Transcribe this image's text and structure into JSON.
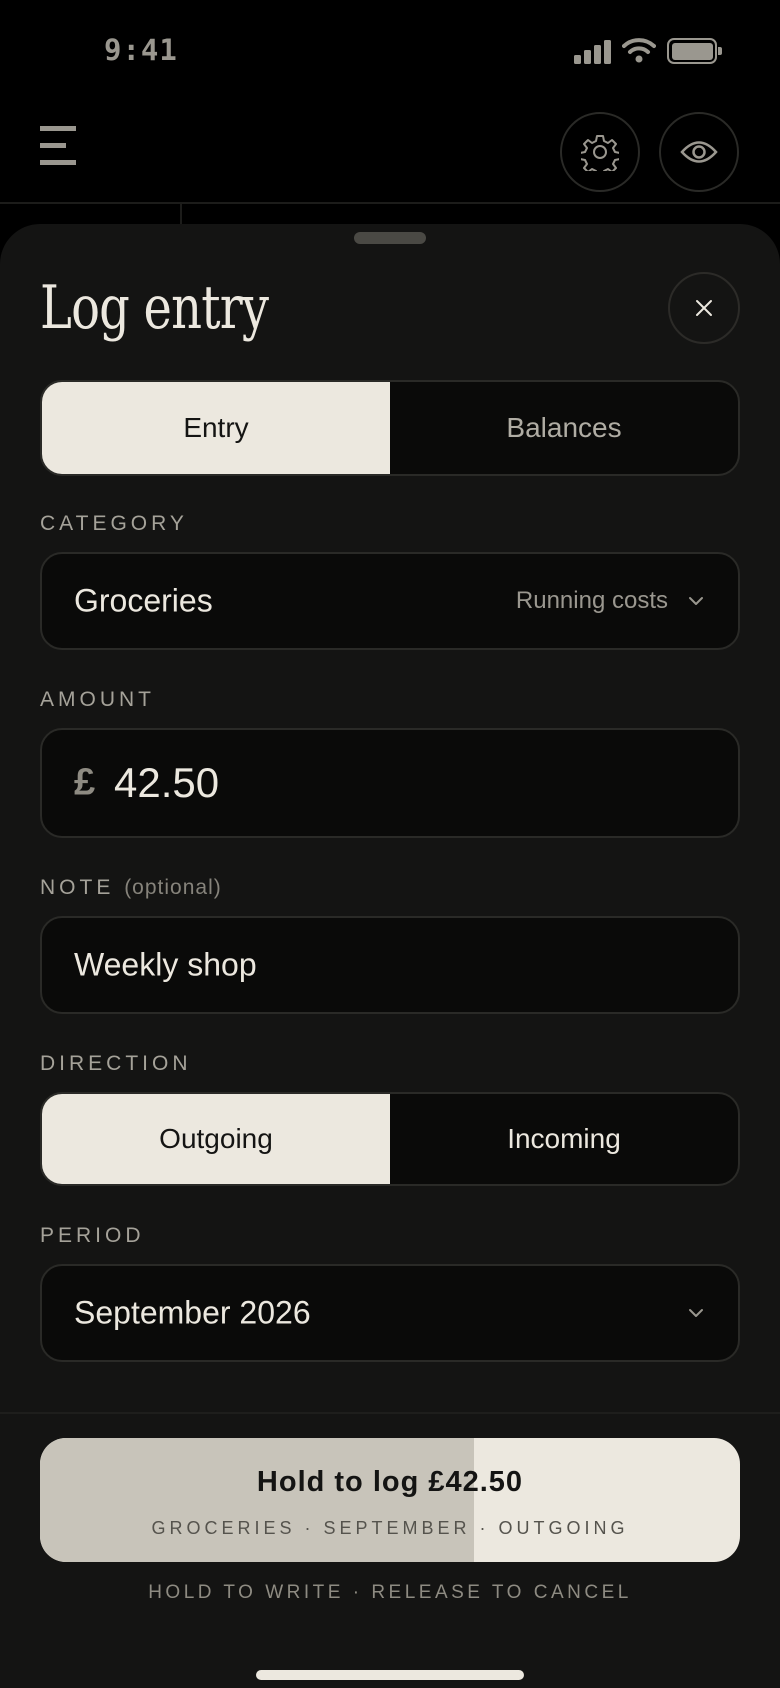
{
  "status_bar": {
    "time": "9:41"
  },
  "sheet": {
    "title": "Log entry"
  },
  "mode_tabs": [
    {
      "label": "Entry",
      "active": true
    },
    {
      "label": "Balances",
      "active": false
    }
  ],
  "category": {
    "label": "CATEGORY",
    "value": "Groceries",
    "group": "Running costs"
  },
  "amount": {
    "label": "AMOUNT",
    "currency": "£",
    "value": "42.50"
  },
  "note": {
    "label": "NOTE",
    "optional": "(optional)",
    "value": "Weekly shop"
  },
  "direction": {
    "label": "DIRECTION",
    "options": [
      {
        "label": "Outgoing",
        "active": true
      },
      {
        "label": "Incoming",
        "active": false
      }
    ]
  },
  "period": {
    "label": "PERIOD",
    "value": "September 2026"
  },
  "hold_button": {
    "label": "Hold to log £42.50",
    "summary": "GROCERIES · SEPTEMBER · OUTGOING",
    "progress": 0.62
  },
  "hint": "HOLD TO WRITE · RELEASE TO CANCEL",
  "colors": {
    "background": "#000000",
    "sheet": "#141413",
    "accent": "#ece8df",
    "muted": "#9a978f"
  },
  "icons": {
    "menu": "menu-icon",
    "settings": "gear-icon",
    "visibility": "eye-icon",
    "close": "close-icon",
    "dropdown": "chevron-down-icon"
  }
}
